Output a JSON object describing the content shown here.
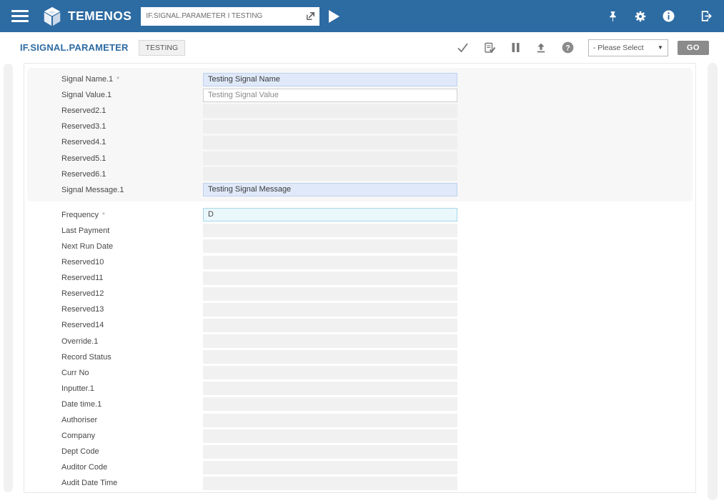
{
  "header": {
    "brand": "TEMENOS",
    "command_value": "IF.SIGNAL.PARAMETER I TESTING"
  },
  "toolbar": {
    "title": "IF.SIGNAL.PARAMETER",
    "tab": "TESTING",
    "select_value": "- Please Select",
    "go": "GO"
  },
  "required_marker": "*",
  "icons": {
    "header": [
      "hamburger-menu-icon",
      "temenos-logo",
      "open-enquiry-icon",
      "run-play-icon",
      "pin-icon",
      "gear-icon",
      "info-icon",
      "logout-icon"
    ],
    "toolbar": [
      "commit-check-icon",
      "validate-doc-icon",
      "hold-pause-icon",
      "upload-icon",
      "help-icon",
      "chevron-down-icon"
    ]
  },
  "colors": {
    "header_bg": "#2d6ba3",
    "title_color": "#2d6ba3",
    "edited_field_bg": "#dfe9f9",
    "edited_field_border": "#bed2f0",
    "focused_field_bg": "#eaf8fc",
    "focused_field_border": "#a9d6e8",
    "readonly_field_bg": "#f1f1f1",
    "group_bg": "#f7f7f7",
    "go_button_bg": "#8b8b8b",
    "toolbar_icon_color": "#777777"
  },
  "form": {
    "groups": [
      {
        "fields": [
          {
            "label": "Signal Name.1",
            "required": true,
            "value": "Testing Signal Name",
            "state": "edited"
          },
          {
            "label": "Signal Value.1",
            "value": "Testing Signal Value",
            "state": "editable"
          },
          {
            "label": "Reserved2.1",
            "state": "readonly"
          },
          {
            "label": "Reserved3.1",
            "state": "readonly"
          },
          {
            "label": "Reserved4.1",
            "state": "readonly"
          },
          {
            "label": "Reserved5.1",
            "state": "readonly"
          },
          {
            "label": "Reserved6.1",
            "state": "readonly"
          },
          {
            "label": "Signal Message.1",
            "value": "Testing Signal Message",
            "state": "edited"
          }
        ]
      },
      {
        "fields": [
          {
            "label": "Frequency",
            "required": true,
            "value": "D",
            "state": "focused"
          },
          {
            "label": "Last Payment",
            "state": "readonly"
          },
          {
            "label": "Next Run Date",
            "state": "readonly"
          },
          {
            "label": "Reserved10",
            "state": "readonly"
          },
          {
            "label": "Reserved11",
            "state": "readonly"
          },
          {
            "label": "Reserved12",
            "state": "readonly"
          },
          {
            "label": "Reserved13",
            "state": "readonly"
          },
          {
            "label": "Reserved14",
            "state": "readonly"
          },
          {
            "label": "Override.1",
            "state": "readonly"
          },
          {
            "label": "Record Status",
            "state": "readonly"
          },
          {
            "label": "Curr No",
            "state": "readonly"
          },
          {
            "label": "Inputter.1",
            "state": "readonly"
          },
          {
            "label": "Date time.1",
            "state": "readonly"
          },
          {
            "label": "Authoriser",
            "state": "readonly"
          },
          {
            "label": "Company",
            "state": "readonly"
          },
          {
            "label": "Dept Code",
            "state": "readonly"
          },
          {
            "label": "Auditor Code",
            "state": "readonly"
          },
          {
            "label": "Audit Date Time",
            "state": "readonly"
          }
        ]
      }
    ]
  }
}
